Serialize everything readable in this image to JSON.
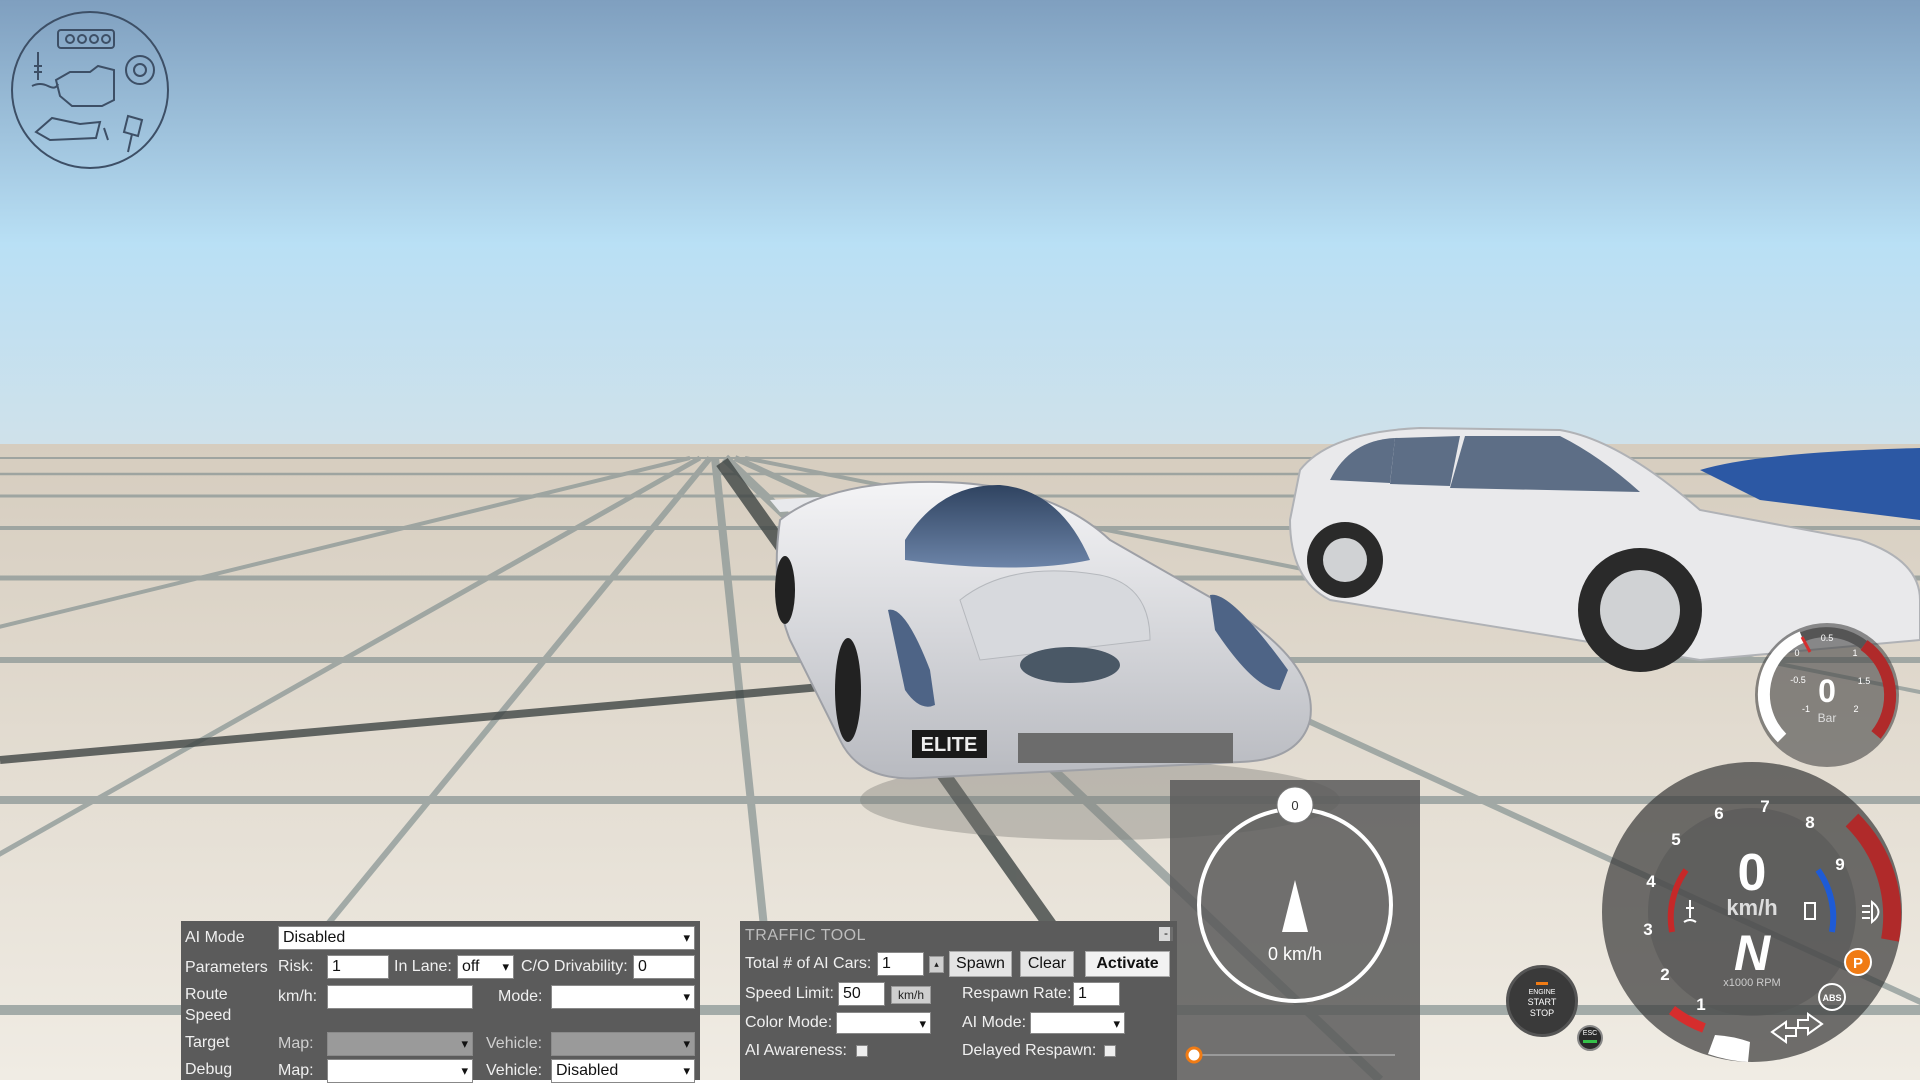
{
  "ai_panel": {
    "ai_mode_label": "AI Mode",
    "ai_mode_value": "Disabled",
    "parameters_label": "Parameters",
    "risk_label": "Risk:",
    "risk_value": "1",
    "in_lane_label": "In Lane:",
    "in_lane_value": "off",
    "co_drivability_label": "C/O Drivability:",
    "co_drivability_value": "0",
    "route_label_1": "Route",
    "route_label_2": "Speed",
    "route_kmh_label": "km/h:",
    "route_speed_value": "",
    "route_mode_label": "Mode:",
    "route_mode_value": "",
    "target_label": "Target",
    "target_map_label": "Map:",
    "target_map_value": "",
    "target_vehicle_label": "Vehicle:",
    "target_vehicle_value": "",
    "debug_label": "Debug",
    "debug_map_label": "Map:",
    "debug_map_value": "",
    "debug_vehicle_label": "Vehicle:",
    "debug_vehicle_value": "Disabled"
  },
  "traffic_tool": {
    "title": "TRAFFIC TOOL",
    "collapse_label": "-",
    "total_cars_label": "Total # of AI Cars:",
    "total_cars_value": "1",
    "spawn_label": "Spawn",
    "clear_label": "Clear",
    "activate_label": "Activate",
    "speed_limit_label": "Speed Limit:",
    "speed_limit_value": "50",
    "speed_unit": "km/h",
    "respawn_rate_label": "Respawn Rate:",
    "respawn_rate_value": "1",
    "color_mode_label": "Color Mode:",
    "color_mode_value": "",
    "ai_mode_label": "AI Mode:",
    "ai_mode_value": "",
    "ai_awareness_label": "AI Awareness:",
    "delayed_respawn_label": "Delayed Respawn:"
  },
  "navigator": {
    "heading_value": "0",
    "speed_text": "0 km/h",
    "slider_fraction": 0
  },
  "boost_gauge": {
    "value": "0",
    "unit": "Bar",
    "ticks": [
      "-1",
      "-0.5",
      "0",
      "0.5",
      "1",
      "1.5",
      "2"
    ]
  },
  "tacho": {
    "speed_value": "0",
    "speed_unit": "km/h",
    "gear": "N",
    "rpm_label": "x1000 RPM",
    "ticks": [
      "1",
      "2",
      "3",
      "4",
      "5",
      "6",
      "7",
      "8",
      "9"
    ],
    "abs_label": "ABS",
    "park_label": "P"
  },
  "engine_button": {
    "line1": "ENGINE",
    "line2": "START",
    "line3": "STOP",
    "esc_label": "ESC"
  },
  "car_plate": "ELITE"
}
